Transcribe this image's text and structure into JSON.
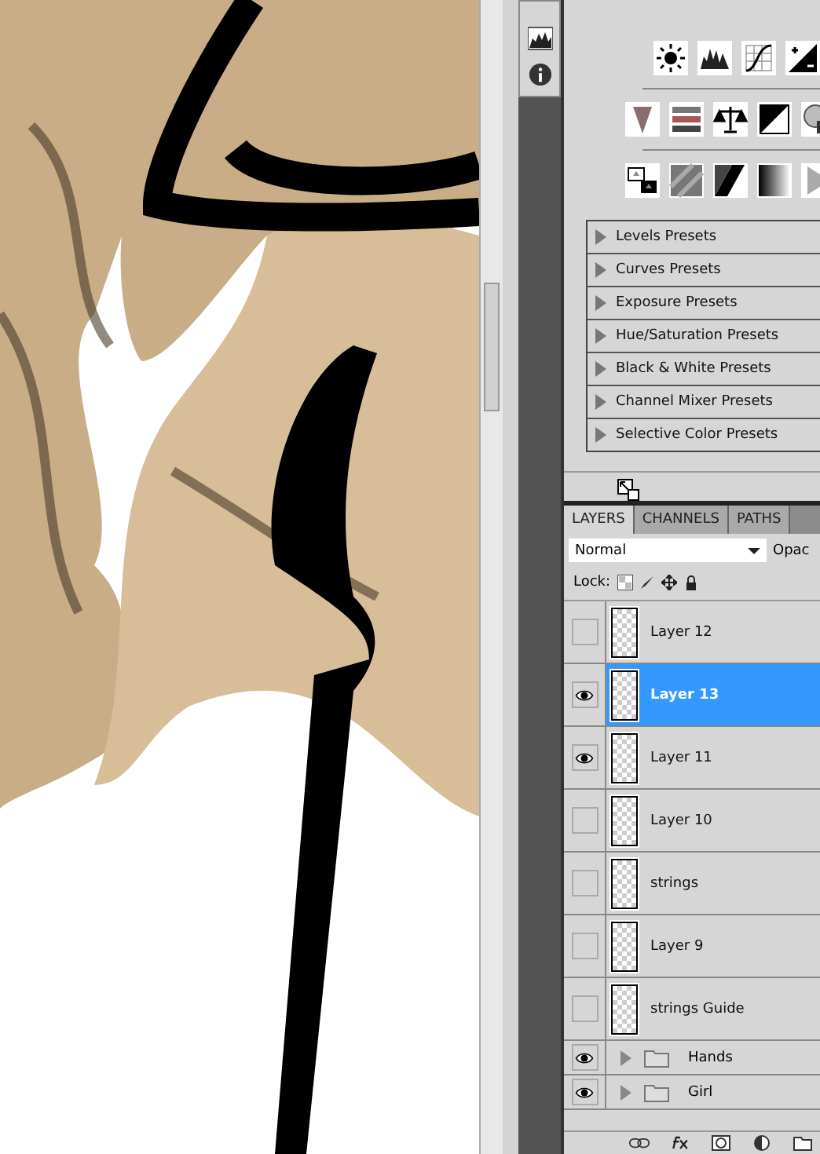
{
  "presets": [
    {
      "label": "Levels Presets",
      "expanded": false
    },
    {
      "label": "Curves Presets",
      "expanded": false
    },
    {
      "label": "Exposure Presets",
      "expanded": false
    },
    {
      "label": "Hue/Saturation Presets",
      "expanded": false
    },
    {
      "label": "Black & White Presets",
      "expanded": false
    },
    {
      "label": "Channel Mixer Presets",
      "expanded": false
    },
    {
      "label": "Selective Color Presets",
      "expanded": false
    }
  ],
  "layers_panel": {
    "tabs": [
      {
        "label": "LAYERS",
        "selected": true
      },
      {
        "label": "CHANNELS",
        "selected": false
      },
      {
        "label": "PATHS",
        "selected": false
      }
    ],
    "blend_mode": "Normal",
    "opacity_label": "Opac",
    "lock_label": "Lock:",
    "layers": [
      {
        "name": "Layer 12",
        "kind": "layer",
        "visible": false,
        "selected": false
      },
      {
        "name": "Layer 13",
        "kind": "layer",
        "visible": true,
        "selected": true
      },
      {
        "name": "Layer 11",
        "kind": "layer",
        "visible": true,
        "selected": false
      },
      {
        "name": "Layer 10",
        "kind": "layer",
        "visible": false,
        "selected": false
      },
      {
        "name": "strings",
        "kind": "layer",
        "visible": false,
        "selected": false
      },
      {
        "name": "Layer 9",
        "kind": "layer",
        "visible": false,
        "selected": false
      },
      {
        "name": "strings Guide",
        "kind": "layer",
        "visible": false,
        "selected": false
      },
      {
        "name": "Hands",
        "kind": "group",
        "visible": true,
        "selected": false
      },
      {
        "name": "Girl",
        "kind": "group",
        "visible": true,
        "selected": false
      }
    ]
  }
}
